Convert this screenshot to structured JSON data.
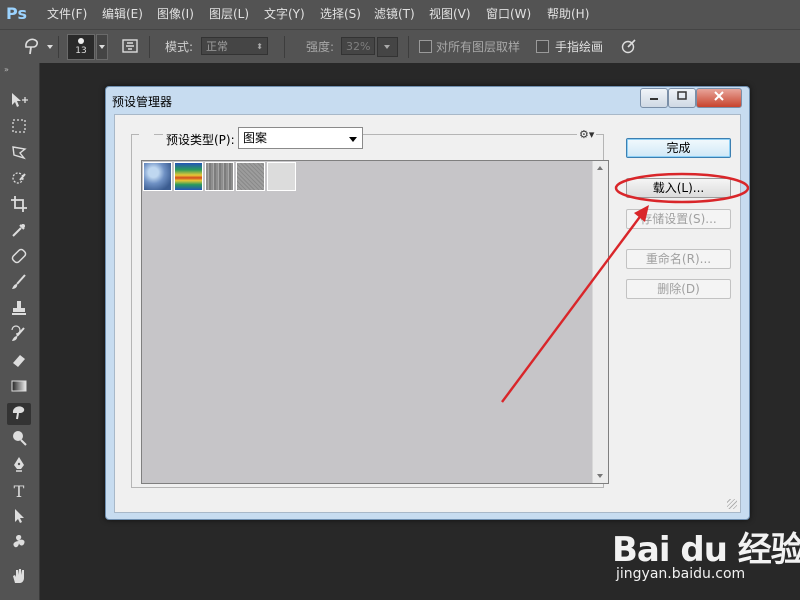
{
  "app": {
    "logo": "Ps"
  },
  "menu": [
    {
      "label": "文件(F)"
    },
    {
      "label": "编辑(E)"
    },
    {
      "label": "图像(I)"
    },
    {
      "label": "图层(L)"
    },
    {
      "label": "文字(Y)"
    },
    {
      "label": "选择(S)"
    },
    {
      "label": "滤镜(T)"
    },
    {
      "label": "视图(V)"
    },
    {
      "label": "窗口(W)"
    },
    {
      "label": "帮助(H)"
    }
  ],
  "options": {
    "brush_size": "13",
    "mode_label": "模式:",
    "mode_value": "正常",
    "strength_label": "强度:",
    "strength_value": "32%",
    "sample_all_layers": "对所有图层取样",
    "finger_painting": "手指绘画"
  },
  "dialog": {
    "title": "预设管理器",
    "preset_type_label": "预设类型(P):",
    "preset_type_value": "图案",
    "buttons": {
      "done": "完成",
      "load": "载入(L)...",
      "save": "存储设置(S)...",
      "rename": "重命名(R)...",
      "delete": "删除(D)"
    },
    "pattern_count": 5
  },
  "watermark": {
    "brand": "Bai du 经验",
    "url": "jingyan.baidu.com"
  },
  "colors": {
    "annotation": "#d9262a",
    "menubar": "#535353",
    "canvas": "#282828"
  },
  "icons": [
    "smudge-icon",
    "gear-icon",
    "minimize-icon",
    "maximize-icon",
    "close-icon"
  ]
}
